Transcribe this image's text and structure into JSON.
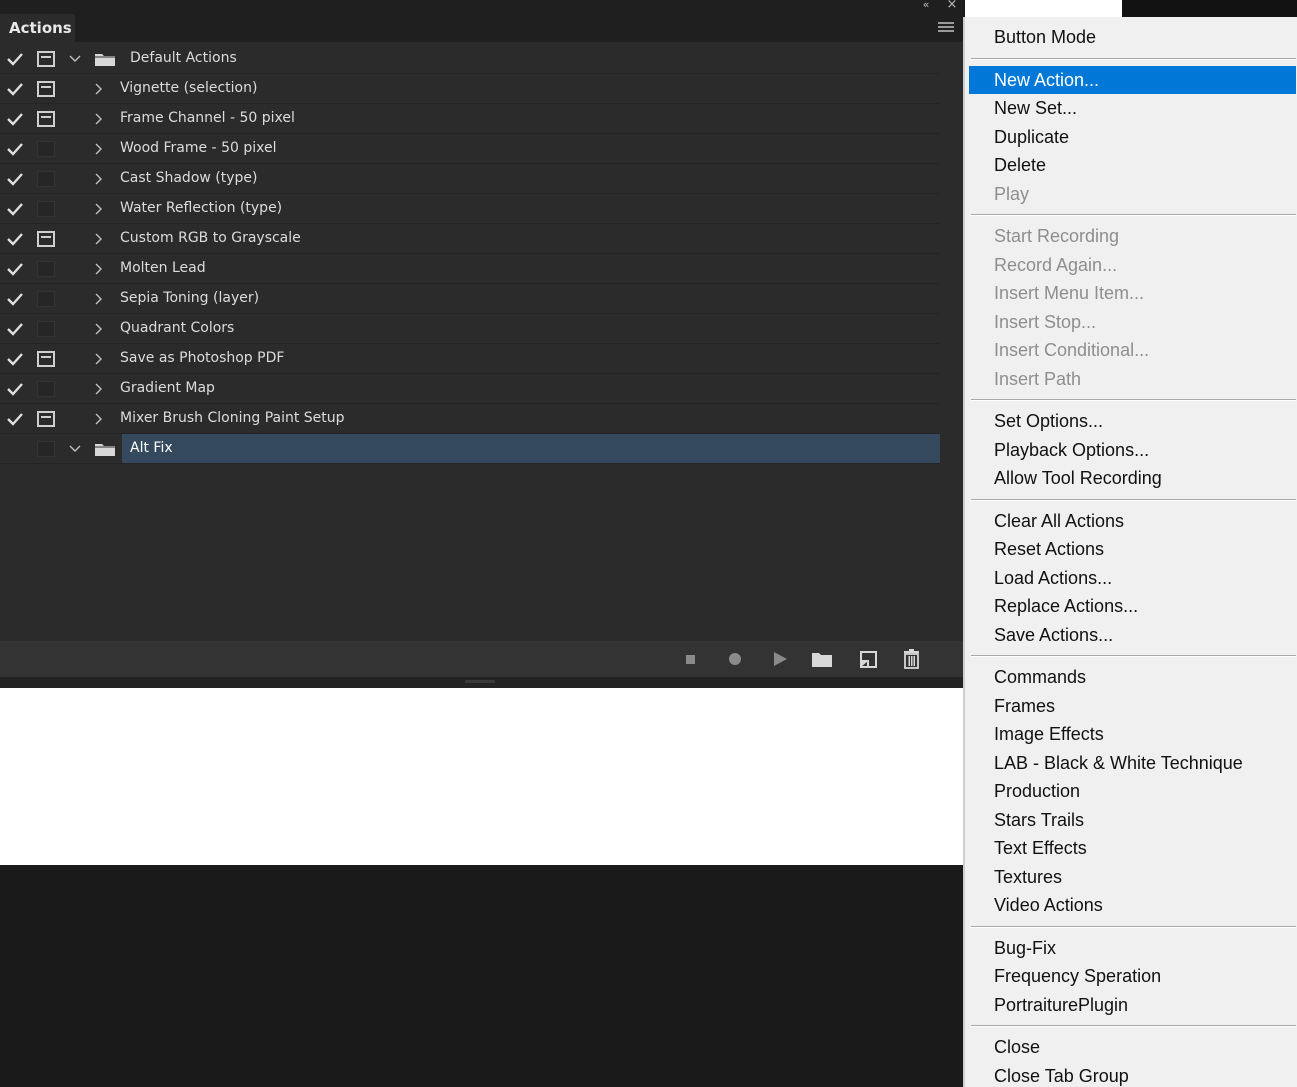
{
  "panel": {
    "tab_label": "Actions",
    "collapse_glyph": "«",
    "close_glyph": "×",
    "rows": [
      {
        "name": "Default Actions",
        "type": "set",
        "expanded": true,
        "checked": true,
        "dialog": true
      },
      {
        "name": "Vignette (selection)",
        "type": "action",
        "checked": true,
        "dialog": true
      },
      {
        "name": "Frame Channel - 50 pixel",
        "type": "action",
        "checked": true,
        "dialog": true
      },
      {
        "name": "Wood Frame - 50 pixel",
        "type": "action",
        "checked": true,
        "dialog": false
      },
      {
        "name": "Cast Shadow (type)",
        "type": "action",
        "checked": true,
        "dialog": false
      },
      {
        "name": "Water Reflection (type)",
        "type": "action",
        "checked": true,
        "dialog": false
      },
      {
        "name": "Custom RGB to Grayscale",
        "type": "action",
        "checked": true,
        "dialog": true
      },
      {
        "name": "Molten Lead",
        "type": "action",
        "checked": true,
        "dialog": false
      },
      {
        "name": "Sepia Toning (layer)",
        "type": "action",
        "checked": true,
        "dialog": false
      },
      {
        "name": "Quadrant Colors",
        "type": "action",
        "checked": true,
        "dialog": false
      },
      {
        "name": "Save as Photoshop PDF",
        "type": "action",
        "checked": true,
        "dialog": true
      },
      {
        "name": "Gradient Map",
        "type": "action",
        "checked": true,
        "dialog": false
      },
      {
        "name": "Mixer Brush Cloning Paint Setup",
        "type": "action",
        "checked": true,
        "dialog": true
      },
      {
        "name": "Alt Fix",
        "type": "set",
        "expanded": true,
        "checked": false,
        "dialog": false,
        "selected": true
      }
    ],
    "bottom_buttons": [
      "stop-icon",
      "record-icon",
      "play-icon",
      "new-set-folder-icon",
      "new-action-icon",
      "delete-trash-icon"
    ]
  },
  "menu": {
    "items": [
      {
        "label": "Button Mode",
        "enabled": true
      },
      {
        "sep": true
      },
      {
        "label": "New Action...",
        "enabled": true,
        "highlighted": true
      },
      {
        "label": "New Set...",
        "enabled": true
      },
      {
        "label": "Duplicate",
        "enabled": true
      },
      {
        "label": "Delete",
        "enabled": true
      },
      {
        "label": "Play",
        "enabled": false
      },
      {
        "sep": true
      },
      {
        "label": "Start Recording",
        "enabled": false
      },
      {
        "label": "Record Again...",
        "enabled": false
      },
      {
        "label": "Insert Menu Item...",
        "enabled": false
      },
      {
        "label": "Insert Stop...",
        "enabled": false
      },
      {
        "label": "Insert Conditional...",
        "enabled": false
      },
      {
        "label": "Insert Path",
        "enabled": false
      },
      {
        "sep": true
      },
      {
        "label": "Set Options...",
        "enabled": true
      },
      {
        "label": "Playback Options...",
        "enabled": true
      },
      {
        "label": "Allow Tool Recording",
        "enabled": true
      },
      {
        "sep": true
      },
      {
        "label": "Clear All Actions",
        "enabled": true
      },
      {
        "label": "Reset Actions",
        "enabled": true
      },
      {
        "label": "Load Actions...",
        "enabled": true
      },
      {
        "label": "Replace Actions...",
        "enabled": true
      },
      {
        "label": "Save Actions...",
        "enabled": true
      },
      {
        "sep": true
      },
      {
        "label": "Commands",
        "enabled": true
      },
      {
        "label": "Frames",
        "enabled": true
      },
      {
        "label": "Image Effects",
        "enabled": true
      },
      {
        "label": "LAB - Black & White Technique",
        "enabled": true
      },
      {
        "label": "Production",
        "enabled": true
      },
      {
        "label": "Stars Trails",
        "enabled": true
      },
      {
        "label": "Text Effects",
        "enabled": true
      },
      {
        "label": "Textures",
        "enabled": true
      },
      {
        "label": "Video Actions",
        "enabled": true
      },
      {
        "sep": true
      },
      {
        "label": "Bug-Fix",
        "enabled": true
      },
      {
        "label": "Frequency Speration",
        "enabled": true
      },
      {
        "label": "PortraiturePlugin",
        "enabled": true
      },
      {
        "sep": true
      },
      {
        "label": "Close",
        "enabled": true
      },
      {
        "label": "Close Tab Group",
        "enabled": true
      }
    ]
  },
  "colors": {
    "panel_bg": "#2b2b2b",
    "selection_bg": "#34495e",
    "menu_bg": "#f0f0f0",
    "menu_highlight": "#0078d7",
    "disabled_text": "#8e8e8e"
  }
}
